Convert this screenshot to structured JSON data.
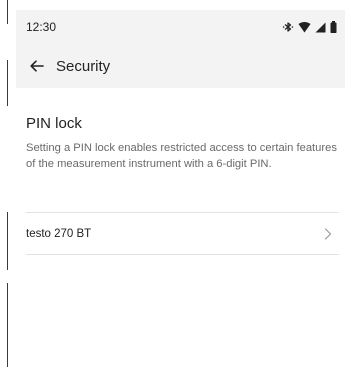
{
  "status_bar": {
    "time": "12:30",
    "icons": [
      "bluetooth-icon",
      "wifi-icon",
      "signal-icon",
      "battery-icon"
    ]
  },
  "app_bar": {
    "back_icon": "arrow-left-icon",
    "title": "Security"
  },
  "pin_lock": {
    "title": "PIN lock",
    "description": "Setting a PIN lock enables restricted access to certain features of the measurement instrument with a 6-digit PIN."
  },
  "devices": [
    {
      "name": "testo 270 BT",
      "chevron_icon": "chevron-right-icon"
    }
  ],
  "colors": {
    "app_bar_bg": "#f3f3f3",
    "text_primary": "#222222",
    "text_secondary": "#6a6a6a",
    "divider": "#e2e2e2"
  }
}
